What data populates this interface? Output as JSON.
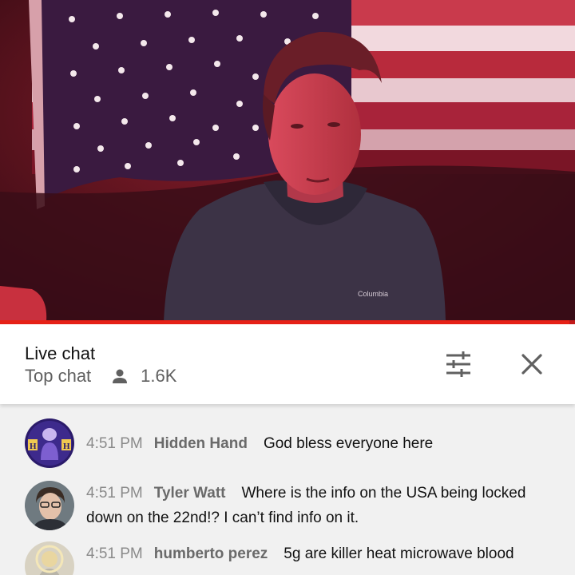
{
  "video": {
    "shirt_logo": "Columbia",
    "progress_fraction": 0.99
  },
  "chat": {
    "title": "Live chat",
    "mode": "Top chat",
    "viewer_count": "1.6K",
    "icons": {
      "viewers": "person-icon",
      "filter": "tune-sliders-icon",
      "close": "close-icon"
    }
  },
  "messages": [
    {
      "time": "4:51 PM",
      "author": "Hidden Hand",
      "text": "God bless everyone here",
      "avatar_badge": "H"
    },
    {
      "time": "4:51 PM",
      "author": "Tyler Watt",
      "text": "Where is the info on the USA being locked down on the 22nd!? I can’t find info on it.",
      "avatar_badge": ""
    },
    {
      "time": "4:51 PM",
      "author": "humberto perez",
      "text": "5g are killer heat microwave blood",
      "avatar_badge": ""
    }
  ],
  "colors": {
    "accent_red": "#e62117",
    "header_bg": "#ffffff",
    "chat_bg": "#f1f1f1",
    "author_gray": "#6a6a6a",
    "time_gray": "#8a8a8a"
  }
}
